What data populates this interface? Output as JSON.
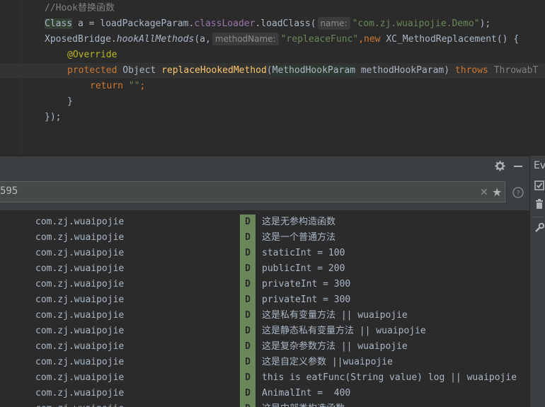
{
  "editor": {
    "comment": "//Hook替换函数",
    "line1": {
      "type": "Class",
      "rest": " a = loadPackageParam.",
      "field": "classLoader",
      "call": ".loadClass(",
      "hint": "name:",
      "arg": "\"com.zj.wuaipojie.Demo\"",
      "end": ");"
    },
    "line2": {
      "cls": "XposedBridge.",
      "method": "hookAllMethods",
      "open": "(a,",
      "hint": "methodName:",
      "arg": "\"repleaceFunc\"",
      "comma": ",",
      "new_kw": "new",
      "rest": " XC_MethodReplacement() {"
    },
    "annotation": "@Override",
    "line4": {
      "kw": "protected",
      "type": " Object ",
      "fn": "replaceHookedMethod",
      "open": "(",
      "ptype": "MethodHookParam",
      "pname": " methodHookParam) ",
      "throws": "throws",
      "exc": " ThrowabT"
    },
    "line5": {
      "kw": "return",
      "str": " \"\"",
      "end": ";"
    },
    "close1": "}",
    "close2": "});"
  },
  "toolwindow": {
    "settings_icon": "gear-icon",
    "minimize_icon": "minimize-icon",
    "side_label": "Ev",
    "search": {
      "value": "595",
      "clear_icon": "clear-icon",
      "star_icon": "star-icon",
      "help_icon": "help-icon"
    }
  },
  "log": {
    "rows": [
      {
        "pkg": "com.zj.wuaipojie",
        "level": "D",
        "msg": "这是无参构造函数"
      },
      {
        "pkg": "com.zj.wuaipojie",
        "level": "D",
        "msg": "这是一个普通方法"
      },
      {
        "pkg": "com.zj.wuaipojie",
        "level": "D",
        "msg": "staticInt = 100"
      },
      {
        "pkg": "com.zj.wuaipojie",
        "level": "D",
        "msg": "publicInt = 200"
      },
      {
        "pkg": "com.zj.wuaipojie",
        "level": "D",
        "msg": "privateInt = 300"
      },
      {
        "pkg": "com.zj.wuaipojie",
        "level": "D",
        "msg": "privateInt = 300"
      },
      {
        "pkg": "com.zj.wuaipojie",
        "level": "D",
        "msg": "这是私有变量方法 || wuaipojie"
      },
      {
        "pkg": "com.zj.wuaipojie",
        "level": "D",
        "msg": "这是静态私有变量方法 || wuaipojie"
      },
      {
        "pkg": "com.zj.wuaipojie",
        "level": "D",
        "msg": "这是复杂参数方法 || wuaipojie"
      },
      {
        "pkg": "com.zj.wuaipojie",
        "level": "D",
        "msg": "这是自定义参数 ||wuaipojie"
      },
      {
        "pkg": "com.zj.wuaipojie",
        "level": "D",
        "msg": "this is eatFunc(String value) log || wuaipojie"
      },
      {
        "pkg": "com.zj.wuaipojie",
        "level": "D",
        "msg": "AnimalInt =  400"
      },
      {
        "pkg": "com.zj.wuaipojie",
        "level": "D",
        "msg": "这是内部类构造函数"
      }
    ]
  },
  "colors": {
    "debug_level": "#6a8759",
    "background": "#2b2b2b",
    "panel": "#3c3f41"
  }
}
